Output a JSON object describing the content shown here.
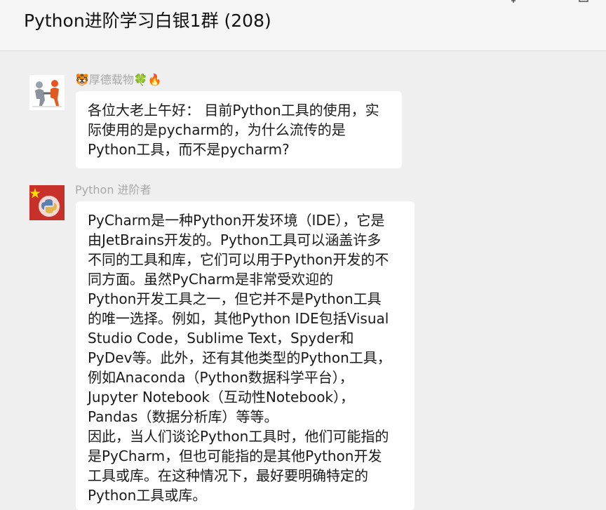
{
  "window": {
    "title": "Python进阶学习白银1群 (208)",
    "pin_icon": "pin-icon",
    "minimize_icon": "minimize-icon",
    "maximize_icon": "maximize-icon"
  },
  "messages": [
    {
      "sender": "🐯厚德载物🍀🔥",
      "avatar_icon": "handshake-avatar",
      "lines": [
        "各位大老上午好： 目前Python工具的使用，实",
        "际使用的是pycharm的，为什么流传的是",
        "Python工具，而不是pycharm?"
      ]
    },
    {
      "sender": "Python 进阶者",
      "avatar_icon": "flag-python-avatar",
      "lines": [
        "PyCharm是一种Python开发环境（IDE），它是",
        "由JetBrains开发的。Python工具可以涵盖许多",
        "不同的工具和库，它们可以用于Python开发的不",
        "同方面。虽然PyCharm是非常受欢迎的",
        "Python开发工具之一，但它并不是Python工具",
        "的唯一选择。例如，其他Python IDE包括Visual",
        "Studio Code，Sublime Text，Spyder和",
        "PyDev等。此外，还有其他类型的Python工具，",
        "例如Anaconda（Python数据科学平台），",
        "Jupyter Notebook（互动性Notebook），",
        "Pandas（数据分析库）等等。",
        "因此，当人们谈论Python工具时，他们可能指的",
        "是PyCharm，但也可能指的是其他Python开发",
        "工具或库。在这种情况下，最好要明确特定的",
        "Python工具或库。"
      ]
    }
  ]
}
